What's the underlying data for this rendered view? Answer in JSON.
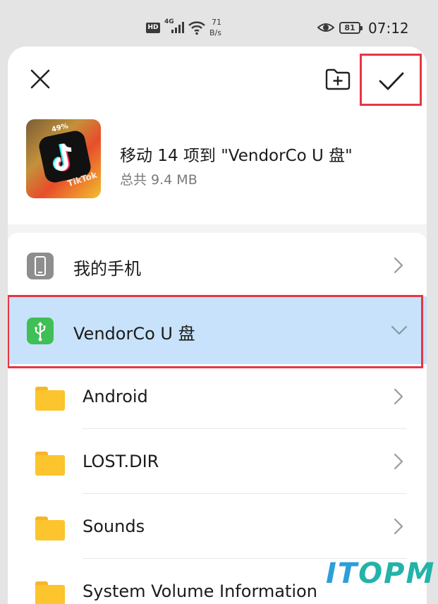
{
  "status_bar": {
    "hd": "HD",
    "network": "4G",
    "speed_value": "71",
    "speed_unit": "B/s",
    "battery": "81",
    "time": "07:12"
  },
  "header": {
    "close_icon": "close-icon",
    "new_folder_icon": "new-folder-icon",
    "confirm_icon": "checkmark-icon"
  },
  "summary": {
    "title": "移动 14 项到 \"VendorCo U 盘\"",
    "total": "总共 9.4 MB",
    "thumbnail_text": "TikTok",
    "thumbnail_percent": "49%"
  },
  "locations": [
    {
      "label": "我的手机",
      "icon": "phone-icon"
    },
    {
      "label": "VendorCo U 盘",
      "icon": "usb-icon",
      "expanded": true
    }
  ],
  "folders": [
    {
      "label": "Android"
    },
    {
      "label": "LOST.DIR"
    },
    {
      "label": "Sounds"
    },
    {
      "label": "System Volume Information"
    }
  ],
  "watermark": {
    "part1": "IT",
    "part2": "OPM"
  },
  "colors": {
    "highlight_border": "#e63644",
    "selected_row": "#c8e2fb",
    "usb_icon_bg": "#3fbf55",
    "folder": "#fcc42d"
  }
}
